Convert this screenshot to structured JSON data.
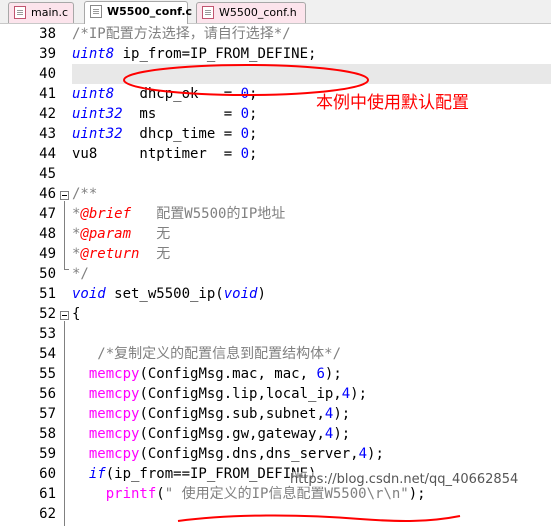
{
  "tabs": [
    {
      "label": "main.c",
      "active": false
    },
    {
      "label": "W5500_conf.c",
      "active": true
    },
    {
      "label": "W5500_conf.h",
      "active": false
    }
  ],
  "annotation": "本例中使用默认配置",
  "watermark": "https://blog.csdn.net/qq_40662854",
  "colors": {
    "keyword": "#0000ff",
    "comment": "#808080",
    "doc_tag": "#ff0000",
    "function": "#ff00ff",
    "annotation": "#ff0000"
  },
  "lines": [
    {
      "n": "38",
      "parts": [
        [
          "cm",
          "/*IP配置方法选择，请自行选择*/"
        ]
      ]
    },
    {
      "n": "39",
      "parts": [
        [
          "kw",
          "uint8"
        ],
        [
          "",
          " ip_from=IP_FROM_DEFINE;"
        ]
      ]
    },
    {
      "n": "40",
      "parts": []
    },
    {
      "n": "41",
      "parts": [
        [
          "kw",
          "uint8"
        ],
        [
          "",
          "   dhcp_ok   = "
        ],
        [
          "num",
          "0"
        ],
        [
          "",
          ";"
        ]
      ]
    },
    {
      "n": "42",
      "parts": [
        [
          "kw",
          "uint32"
        ],
        [
          "",
          "  ms        = "
        ],
        [
          "num",
          "0"
        ],
        [
          "",
          ";"
        ]
      ]
    },
    {
      "n": "43",
      "parts": [
        [
          "kw",
          "uint32"
        ],
        [
          "",
          "  dhcp_time = "
        ],
        [
          "num",
          "0"
        ],
        [
          "",
          ";"
        ]
      ]
    },
    {
      "n": "44",
      "parts": [
        [
          "",
          "vu8     ntptimer  = "
        ],
        [
          "num",
          "0"
        ],
        [
          "",
          ";"
        ]
      ]
    },
    {
      "n": "45",
      "parts": []
    },
    {
      "n": "46",
      "parts": [
        [
          "cm",
          "/**"
        ]
      ]
    },
    {
      "n": "47",
      "parts": [
        [
          "cm",
          "*"
        ],
        [
          "cm-tag",
          "@brief"
        ],
        [
          "cm",
          "   配置W5500的IP地址"
        ]
      ]
    },
    {
      "n": "48",
      "parts": [
        [
          "cm",
          "*"
        ],
        [
          "cm-tag",
          "@param"
        ],
        [
          "cm",
          "   无"
        ]
      ]
    },
    {
      "n": "49",
      "parts": [
        [
          "cm",
          "*"
        ],
        [
          "cm-tag",
          "@return"
        ],
        [
          "cm",
          "  无"
        ]
      ]
    },
    {
      "n": "50",
      "parts": [
        [
          "cm",
          "*/"
        ]
      ]
    },
    {
      "n": "51",
      "parts": [
        [
          "kw",
          "void"
        ],
        [
          "",
          " set_w5500_ip("
        ],
        [
          "kw",
          "void"
        ],
        [
          "",
          ")"
        ]
      ]
    },
    {
      "n": "52",
      "parts": [
        [
          "",
          "{"
        ]
      ]
    },
    {
      "n": "53",
      "parts": []
    },
    {
      "n": "54",
      "parts": [
        [
          "cm",
          "   /*复制定义的配置信息到配置结构体*/"
        ]
      ]
    },
    {
      "n": "55",
      "parts": [
        [
          "",
          "  "
        ],
        [
          "fn",
          "memcpy"
        ],
        [
          "",
          "(ConfigMsg.mac, mac, "
        ],
        [
          "num",
          "6"
        ],
        [
          "",
          ");"
        ]
      ]
    },
    {
      "n": "56",
      "parts": [
        [
          "",
          "  "
        ],
        [
          "fn",
          "memcpy"
        ],
        [
          "",
          "(ConfigMsg.lip,local_ip,"
        ],
        [
          "num",
          "4"
        ],
        [
          "",
          ");"
        ]
      ]
    },
    {
      "n": "57",
      "parts": [
        [
          "",
          "  "
        ],
        [
          "fn",
          "memcpy"
        ],
        [
          "",
          "(ConfigMsg.sub,subnet,"
        ],
        [
          "num",
          "4"
        ],
        [
          "",
          ");"
        ]
      ]
    },
    {
      "n": "58",
      "parts": [
        [
          "",
          "  "
        ],
        [
          "fn",
          "memcpy"
        ],
        [
          "",
          "(ConfigMsg.gw,gateway,"
        ],
        [
          "num",
          "4"
        ],
        [
          "",
          ");"
        ]
      ]
    },
    {
      "n": "59",
      "parts": [
        [
          "",
          "  "
        ],
        [
          "fn",
          "memcpy"
        ],
        [
          "",
          "(ConfigMsg.dns,dns_server,"
        ],
        [
          "num",
          "4"
        ],
        [
          "",
          ");"
        ]
      ]
    },
    {
      "n": "60",
      "parts": [
        [
          "",
          "  "
        ],
        [
          "kw",
          "if"
        ],
        [
          "",
          "(ip_from==IP_FROM_DEFINE)"
        ]
      ]
    },
    {
      "n": "61",
      "parts": [
        [
          "",
          "    "
        ],
        [
          "fn",
          "printf"
        ],
        [
          "",
          "("
        ],
        [
          "str",
          "\" 使用定义的IP信息配置W5500\\r\\n\""
        ],
        [
          "",
          ");"
        ]
      ]
    },
    {
      "n": "62",
      "parts": []
    }
  ]
}
